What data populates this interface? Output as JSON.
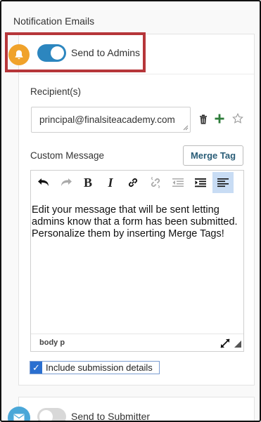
{
  "section": {
    "title": "Notification Emails"
  },
  "admins": {
    "toggle_label": "Send to Admins",
    "toggle_on": true,
    "bell_color": "#f0a22a",
    "toggle_color": "#2c86bf",
    "highlight_color": "#b6363a"
  },
  "recipients": {
    "label": "Recipient(s)",
    "value": "principal@finalsiteacademy.com"
  },
  "recipient_actions": {
    "delete_icon": "trash-icon",
    "add_icon": "plus-icon",
    "favorite_icon": "star-icon"
  },
  "custom_message": {
    "label": "Custom Message",
    "merge_tag_button": "Merge Tag",
    "body": "Edit your message that will be sent letting admins know that a form has been submitted. Personalize them by inserting Merge Tags!",
    "status_path": "body   p"
  },
  "toolbar": {
    "buttons": [
      "undo",
      "redo",
      "bold",
      "italic",
      "link",
      "unlink",
      "outdent",
      "indent",
      "align-left"
    ],
    "bold_glyph": "B",
    "italic_glyph": "I",
    "active": "align-left"
  },
  "include_details": {
    "label": "Include submission details",
    "checked": true
  },
  "submitter": {
    "toggle_label": "Send to Submitter",
    "toggle_on": false
  }
}
